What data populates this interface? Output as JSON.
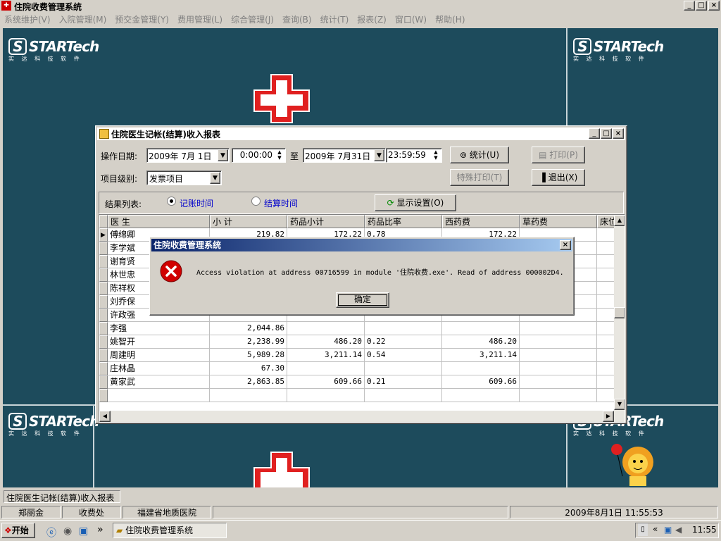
{
  "app": {
    "title": "住院收费管理系统",
    "title_buttons": [
      "_",
      "□",
      "×"
    ]
  },
  "menu": [
    "系统维护(V)",
    "入院管理(M)",
    "预交金管理(Y)",
    "费用管理(L)",
    "综合管理(J)",
    "查询(B)",
    "统计(T)",
    "报表(Z)",
    "窗口(W)",
    "帮助(H)"
  ],
  "branding": {
    "logo_text": "STARTech",
    "logo_sub": "实 达 科 技 软 件",
    "logo_mark": "S"
  },
  "report": {
    "title": "住院医生记帐(结算)收入报表",
    "op_date_label": "操作日期:",
    "date_from": "2009年 7月 1日",
    "time_from": "0:00:00",
    "to_label": "至",
    "date_to": "2009年 7月31日",
    "time_to": "23:59:59",
    "item_level_label": "项目级别:",
    "item_level_value": "发票项目",
    "stats_btn": "统计(U)",
    "print_btn": "打印(P)",
    "special_print_btn": "特殊打印(T)",
    "exit_btn": "退出(X)",
    "result_label": "结果列表:",
    "radio_account": "记账时间",
    "radio_settle": "结算时间",
    "display_btn": "显示设置(O)",
    "columns": [
      "医  生",
      "小 计",
      "药品小计",
      "药品比率",
      "西药费",
      "草药费",
      "床位"
    ],
    "rows": [
      {
        "doctor": "傅绵卿",
        "subtotal": "219.82",
        "drug": "172.22",
        "ratio": "0.78",
        "western": "172.22",
        "herbal": ""
      },
      {
        "doctor": "李学斌",
        "subtotal": "",
        "drug": "",
        "ratio": "",
        "western": "",
        "herbal": ""
      },
      {
        "doctor": "谢育贤",
        "subtotal": "",
        "drug": "",
        "ratio": "",
        "western": "",
        "herbal": ""
      },
      {
        "doctor": "林世忠",
        "subtotal": "",
        "drug": "",
        "ratio": "",
        "western": "",
        "herbal": ""
      },
      {
        "doctor": "陈祥权",
        "subtotal": "",
        "drug": "",
        "ratio": "",
        "western": "",
        "herbal": ""
      },
      {
        "doctor": "刘乔保",
        "subtotal": "",
        "drug": "",
        "ratio": "",
        "western": "",
        "herbal": ""
      },
      {
        "doctor": "许政强",
        "subtotal": "",
        "drug": "",
        "ratio": "",
        "western": "",
        "herbal": ""
      },
      {
        "doctor": "李强",
        "subtotal": "2,044.86",
        "drug": "",
        "ratio": "",
        "western": "",
        "herbal": ""
      },
      {
        "doctor": "姚智开",
        "subtotal": "2,238.99",
        "drug": "486.20",
        "ratio": "0.22",
        "western": "486.20",
        "herbal": ""
      },
      {
        "doctor": "周建明",
        "subtotal": "5,989.28",
        "drug": "3,211.14",
        "ratio": "0.54",
        "western": "3,211.14",
        "herbal": ""
      },
      {
        "doctor": "庄林晶",
        "subtotal": "67.30",
        "drug": "",
        "ratio": "",
        "western": "",
        "herbal": ""
      },
      {
        "doctor": "黄家武",
        "subtotal": "2,863.85",
        "drug": "609.66",
        "ratio": "0.21",
        "western": "609.66",
        "herbal": ""
      }
    ]
  },
  "dialog": {
    "title": "住院收费管理系统",
    "message": "Access violation at address 00716599 in module '住院收费.exe'. Read of address 000002D4.",
    "ok_btn": "确定",
    "close": "×"
  },
  "window_tab": "住院医生记帐(结算)收入报表",
  "status": {
    "user": "郑丽金",
    "dept": "收费处",
    "hospital": "福建省地质医院",
    "datetime": "2009年8月1日  11:55:53"
  },
  "taskbar": {
    "start": "开始",
    "task": "住院收费管理系统",
    "clock": "11:55",
    "chevron": "»",
    "tray_chevron": "«"
  },
  "colors": {
    "desktop": "#1d4b5c",
    "cross": "#e02020",
    "title_active": "#0a246a",
    "link_blue": "#0000cc"
  }
}
